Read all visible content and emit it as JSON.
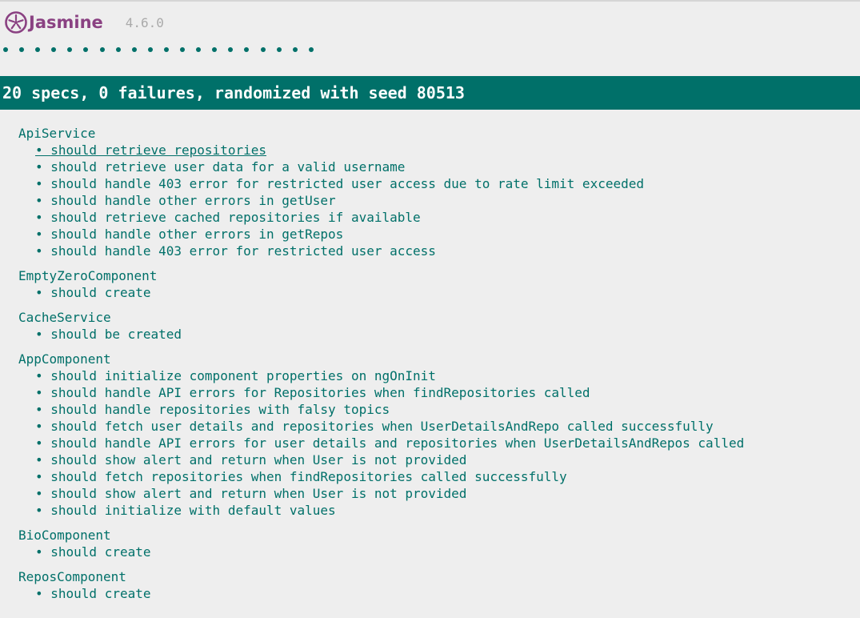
{
  "header": {
    "brand": "Jasmine",
    "version": "4.6.0"
  },
  "dots": {
    "count": 20
  },
  "summary": {
    "text": "20 specs, 0 failures, randomized with seed 80513"
  },
  "suites": [
    {
      "name": "ApiService",
      "specs": [
        "should retrieve repositories",
        "should retrieve user data for a valid username",
        "should handle 403 error for restricted user access due to rate limit exceeded",
        "should handle other errors in getUser",
        "should retrieve cached repositories if available",
        "should handle other errors in getRepos",
        "should handle 403 error for restricted user access"
      ]
    },
    {
      "name": "EmptyZeroComponent",
      "specs": [
        "should create"
      ]
    },
    {
      "name": "CacheService",
      "specs": [
        "should be created"
      ]
    },
    {
      "name": "AppComponent",
      "specs": [
        "should initialize component properties on ngOnInit",
        "should handle API errors for Repositories when findRepositories called",
        "should handle repositories with falsy topics",
        "should fetch user details and repositories when UserDetailsAndRepo called successfully",
        "should handle API errors for user details and repositories when UserDetailsAndRepos called",
        "should show alert and return when User is not provided",
        "should fetch repositories when findRepositories called successfully",
        "should show alert and return when User is not provided",
        "should initialize with default values"
      ]
    },
    {
      "name": "BioComponent",
      "specs": [
        "should create"
      ]
    },
    {
      "name": "ReposComponent",
      "specs": [
        "should create"
      ]
    }
  ],
  "colors": {
    "accent": "#007069",
    "brand": "#8a4182",
    "background": "#eeeeee",
    "version": "#aaaaaa"
  }
}
